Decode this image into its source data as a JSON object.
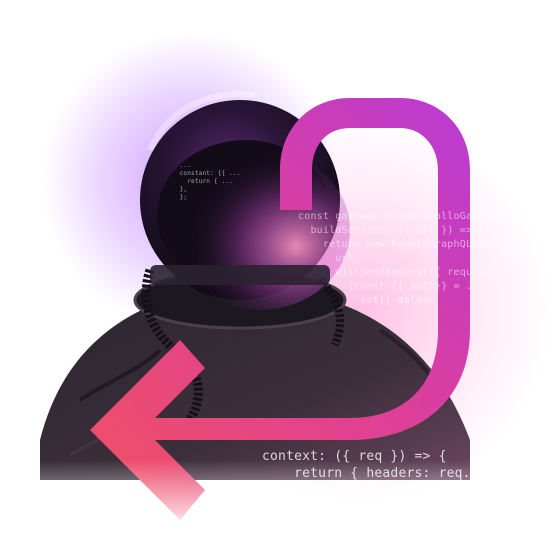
{
  "colors": {
    "arrow_start": "#f25260",
    "arrow_end": "#c23bd4",
    "glow_purple": "#a950ff",
    "glow_pink": "#ff78c8",
    "helmet_dark": "#1b1024"
  },
  "code_top": "const gateway = new ApolloGateway({\n  buildService: ({ url }) => {\n    return new RemoteGraphQLDataSource({\n      url,\n      willSendRequest({ request,\n        (const {{ auth}} = ...\n          set({ dataSo",
  "code_helmet": "  ...\n  constant: {{ ...\n    return { ...\n  },\n  };",
  "code_bottom": "context: ({ req }) => {\n    return { headers: req.headers },\n  },\n});"
}
